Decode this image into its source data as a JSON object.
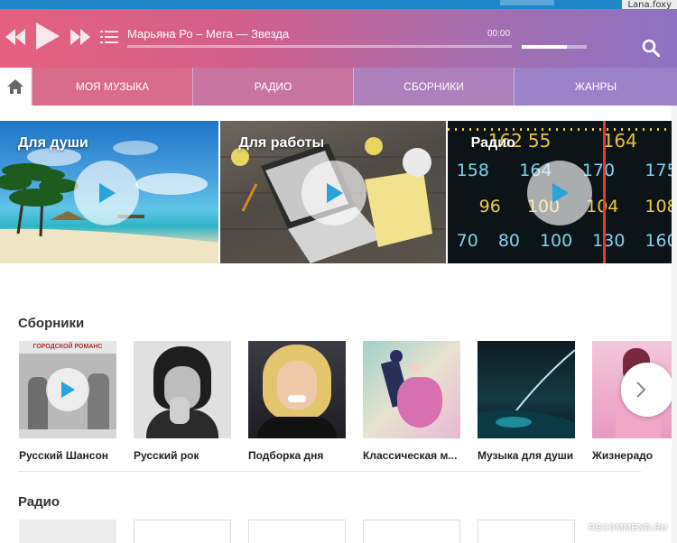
{
  "user": {
    "name": "Lana.foxy"
  },
  "player": {
    "track": "Марьяна Ро – Мега — Звезда",
    "time": "00:00",
    "progress": 0.0,
    "volume": 0.7
  },
  "nav": {
    "items": [
      "МОЯ МУЗЫКА",
      "РАДИО",
      "СБОРНИКИ",
      "ЖАНРЫ"
    ]
  },
  "banners": [
    {
      "label": "Для души"
    },
    {
      "label": "Для работы"
    },
    {
      "label": "Радио"
    }
  ],
  "radio_dial": {
    "top": [
      "162",
      "55",
      "164"
    ],
    "row1": [
      "158",
      "164",
      "170",
      "175"
    ],
    "row2": [
      "96",
      "100",
      "104",
      "108"
    ],
    "row3": [
      "70",
      "80",
      "100",
      "130",
      "160"
    ]
  },
  "collections": {
    "title": "Сборники",
    "items": [
      {
        "name": "Русский Шансон",
        "cover_text": "ГОРОДСКОЙ РОМАНС"
      },
      {
        "name": "Русский рок"
      },
      {
        "name": "Подборка дня"
      },
      {
        "name": "Классическая м..."
      },
      {
        "name": "Музыка для души"
      },
      {
        "name": "Жизнерадо"
      }
    ]
  },
  "radio_section": {
    "title": "Радио"
  },
  "watermark": "RECOMMEND.RU",
  "colors": {
    "accent_start": "#e5607f",
    "accent_end": "#8d72c2",
    "top_bar": "#1f86c9"
  }
}
